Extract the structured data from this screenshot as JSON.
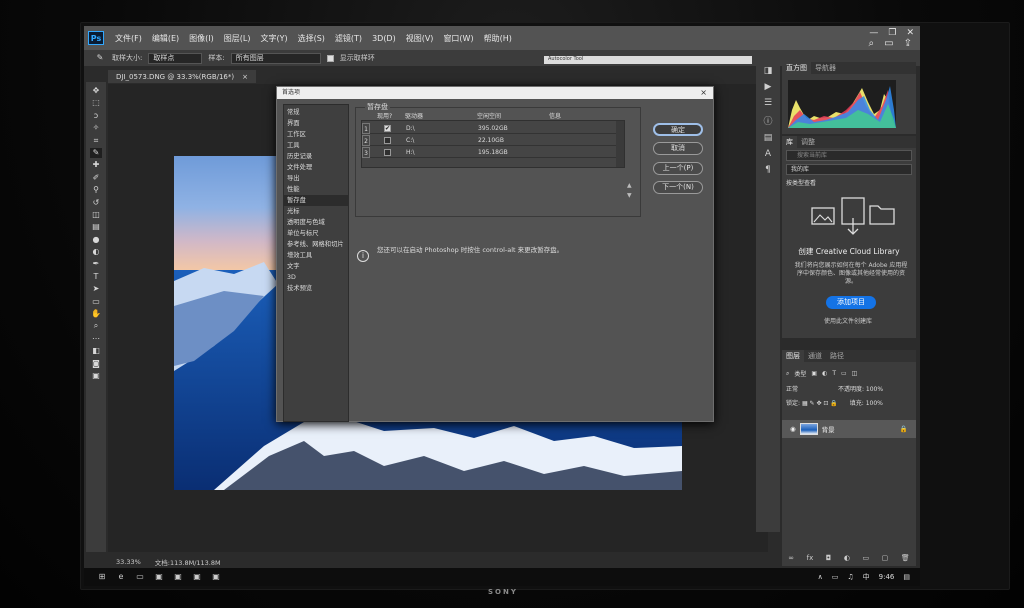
{
  "app": {
    "logo": "Ps",
    "menus": [
      "文件(F)",
      "编辑(E)",
      "图像(I)",
      "图层(L)",
      "文字(Y)",
      "选择(S)",
      "滤镜(T)",
      "3D(D)",
      "视图(V)",
      "窗口(W)",
      "帮助(H)"
    ]
  },
  "options_bar": {
    "sample_size_label": "取样大小:",
    "sample_size_value": "取样点",
    "sample_label": "样本:",
    "sample_value": "所有图层",
    "show_ring_label": "显示取样环",
    "tiny_field": "Autocolor Tool"
  },
  "document": {
    "tab_title": "DJI_0573.DNG @ 33.3%(RGB/16*)",
    "close": "×"
  },
  "dialog": {
    "title": "首选项",
    "close": "×",
    "categories": [
      "常规",
      "界面",
      "工作区",
      "工具",
      "历史记录",
      "文件处理",
      "导出",
      "性能",
      "暂存盘",
      "光标",
      "透明度与色域",
      "单位与标尺",
      "参考线、网格和切片",
      "增效工具",
      "文字",
      "3D",
      "技术预览"
    ],
    "active_category": "暂存盘",
    "group_title": "暂存盘",
    "columns": [
      "现用?",
      "驱动器",
      "空闲空间",
      "信息"
    ],
    "rows": [
      {
        "num": "1",
        "active": "✔",
        "drive": "D:\\",
        "free": "395.02GB",
        "info": ""
      },
      {
        "num": "2",
        "active": "",
        "drive": "C:\\",
        "free": "22.10GB",
        "info": ""
      },
      {
        "num": "3",
        "active": "",
        "drive": "H:\\",
        "free": "195.18GB",
        "info": ""
      }
    ],
    "info_text": "您还可以在启动 Photoshop 时按住 control-alt 来更改暂存盘。",
    "buttons": {
      "ok": "确定",
      "cancel": "取消",
      "prev": "上一个(P)",
      "next": "下一个(N)"
    }
  },
  "panels": {
    "histogram_tabs": [
      "直方图",
      "导航器"
    ],
    "library_tabs": [
      "库",
      "调整"
    ],
    "library_search": "搜索当前库",
    "library_select": "我的库",
    "library_view": "按类型查看",
    "cc_title": "创建 Creative Cloud Library",
    "cc_desc": "我们将向您展示如何在每个 Adobe 应用程序中保存颜色、图像或其他经常使用的资源。",
    "cc_button": "添加项目",
    "cc_link": "使用此文件创建库",
    "layers_tabs": [
      "图层",
      "通道",
      "路径"
    ],
    "layers_filter": "类型",
    "blend_mode": "正常",
    "opacity_label": "不透明度:",
    "opacity": "100%",
    "lock_label": "锁定:",
    "fill_label": "填充:",
    "fill": "100%",
    "layer_name": "背景",
    "bottom_icons": [
      "∞",
      "fx",
      "◘",
      "◐",
      "▭",
      "▢",
      "🗑"
    ]
  },
  "status": {
    "zoom": "33.33%",
    "doc": "文档:113.8M/113.8M"
  },
  "taskbar": {
    "time": "9:46",
    "ime": "中"
  },
  "monitor_brand": "SONY"
}
